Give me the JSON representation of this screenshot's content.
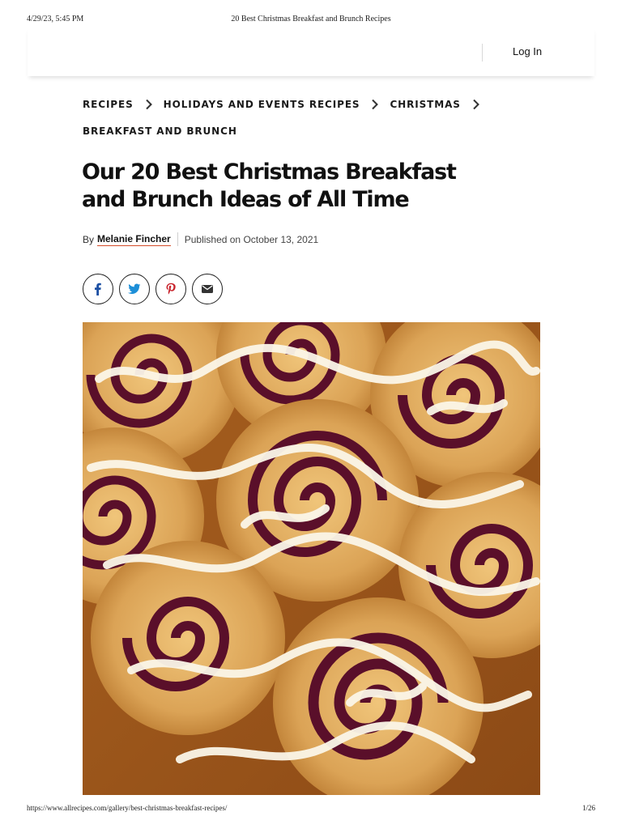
{
  "print_header": {
    "timestamp": "4/29/23, 5:45 PM",
    "document_title": "20 Best Christmas Breakfast and Brunch Recipes"
  },
  "site_header": {
    "login_label": "Log In"
  },
  "breadcrumb": {
    "items": [
      "RECIPES",
      "HOLIDAYS AND EVENTS RECIPES",
      "CHRISTMAS",
      "BREAKFAST AND BRUNCH"
    ]
  },
  "article": {
    "headline": "Our 20 Best Christmas Breakfast and Brunch Ideas of All Time",
    "byline_prefix": "By",
    "author": "Melanie Fincher",
    "published": "Published on October 13, 2021"
  },
  "share": {
    "icons": [
      "facebook-icon",
      "twitter-icon",
      "pinterest-icon",
      "email-icon"
    ]
  },
  "hero_image": {
    "subject": "cranberry cinnamon rolls with white glaze"
  },
  "print_footer": {
    "url": "https://www.allrecipes.com/gallery/best-christmas-breakfast-recipes/",
    "page": "1/26"
  },
  "colors": {
    "author_underline": "#d54d2a",
    "text": "#111111",
    "facebook": "#1b4fa3",
    "twitter": "#1d8fd8",
    "pinterest": "#c8232c"
  }
}
